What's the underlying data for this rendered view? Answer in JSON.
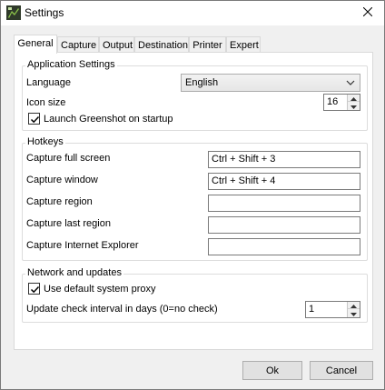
{
  "window": {
    "title": "Settings"
  },
  "tabs": [
    "General",
    "Capture",
    "Output",
    "Destination",
    "Printer",
    "Expert"
  ],
  "application_settings": {
    "title": "Application Settings",
    "language_label": "Language",
    "language_value": "English",
    "icon_size_label": "Icon size",
    "icon_size_value": "16",
    "launch_on_startup_label": "Launch Greenshot on startup",
    "launch_on_startup_checked": true
  },
  "hotkeys": {
    "title": "Hotkeys",
    "items": [
      {
        "label": "Capture full screen",
        "value": "Ctrl + Shift + 3"
      },
      {
        "label": "Capture window",
        "value": "Ctrl + Shift + 4"
      },
      {
        "label": "Capture region",
        "value": ""
      },
      {
        "label": "Capture last region",
        "value": ""
      },
      {
        "label": "Capture Internet Explorer",
        "value": ""
      }
    ]
  },
  "network": {
    "title": "Network and updates",
    "proxy_label": "Use default system proxy",
    "proxy_checked": true,
    "update_interval_label": "Update check interval in days (0=no check)",
    "update_interval_value": "1"
  },
  "buttons": {
    "ok": "Ok",
    "cancel": "Cancel"
  },
  "colors": {
    "panel_bg": "#ffffff",
    "window_bg": "#f0f0f0",
    "border": "#7a7a7a",
    "group_border": "#dcdcdc"
  }
}
